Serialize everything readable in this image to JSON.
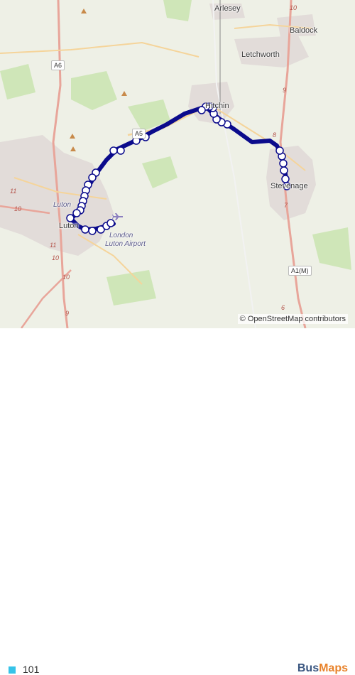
{
  "map": {
    "places": [
      {
        "id": "arlesey",
        "label": "Arlesey"
      },
      {
        "id": "baldock",
        "label": "Baldock"
      },
      {
        "id": "letchworth",
        "label": "Letchworth"
      },
      {
        "id": "hitchin",
        "label": "Hitchin"
      },
      {
        "id": "stevenage",
        "label": "Stevenage"
      },
      {
        "id": "luton",
        "label": "Luton"
      },
      {
        "id": "luton_airport_1",
        "label": "London"
      },
      {
        "id": "luton_airport_2",
        "label": "Luton Airport"
      },
      {
        "id": "luton_area",
        "label": "Luton"
      }
    ],
    "road_shields": [
      {
        "id": "a6",
        "label": "A6"
      },
      {
        "id": "a5",
        "label": "A5"
      },
      {
        "id": "a1m",
        "label": "A1(M)"
      }
    ],
    "road_numbers": [
      "10",
      "9",
      "8",
      "7",
      "6",
      "11",
      "10",
      "9",
      "10",
      "11",
      "10"
    ],
    "attribution": "© OpenStreetMap contributors",
    "route_color": "#0b0b8c"
  },
  "legend": {
    "route_label": "101",
    "route_color": "#36c3e8"
  },
  "brand": {
    "part1": "Bus",
    "part2": "Maps"
  }
}
